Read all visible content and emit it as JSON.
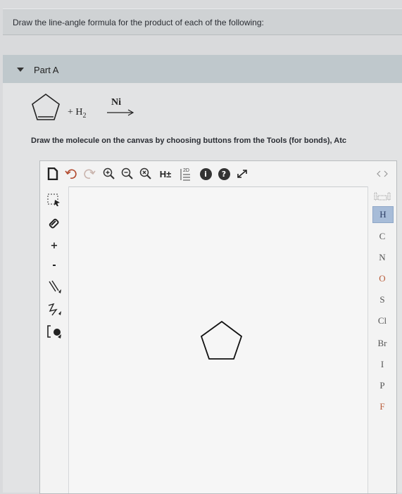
{
  "header": {
    "instruction": "Draw the line-angle formula for the product of each of the following:"
  },
  "part": {
    "label": "Part A"
  },
  "reaction": {
    "plus_reagent": "+ H",
    "reagent_sub": "2",
    "catalyst": "Ni"
  },
  "instruction_text": "Draw the molecule on the canvas by choosing buttons from the Tools (for bonds), Atc",
  "toolbar": {
    "hydrogen_toggle": "H±",
    "two_d_label": "2D",
    "info_icon": "i",
    "help_icon": "?"
  },
  "elements": [
    "H",
    "C",
    "N",
    "O",
    "S",
    "Cl",
    "Br",
    "I",
    "P",
    "F"
  ],
  "colors": {
    "selected_element": "#a7bcd8",
    "header_bg": "#cfd2d4",
    "part_bg": "#bfc8cc"
  }
}
